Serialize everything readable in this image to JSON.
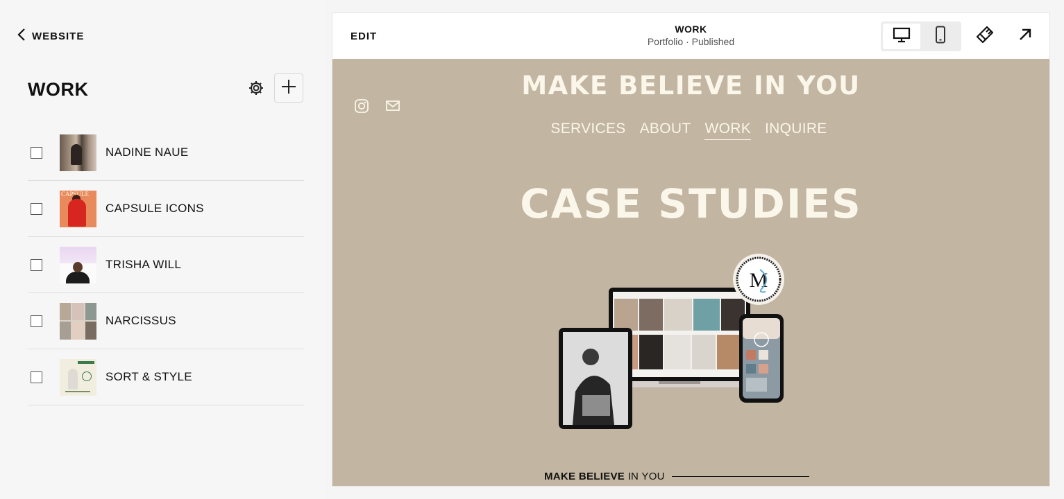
{
  "sidebar": {
    "back_label": "WEBSITE",
    "title": "WORK",
    "items": [
      {
        "label": "NADINE NAUE",
        "checked": false
      },
      {
        "label": "CAPSULE ICONS",
        "checked": false,
        "thumb_text": "CAPSULE"
      },
      {
        "label": "TRISHA WILL",
        "checked": false
      },
      {
        "label": "NARCISSUS",
        "checked": false
      },
      {
        "label": "SORT & STYLE",
        "checked": false
      }
    ]
  },
  "toolbar": {
    "edit_label": "EDIT",
    "page_name": "WORK",
    "page_sub": "Portfolio · Published",
    "active_device": "desktop"
  },
  "site": {
    "title": "MAKE BELIEVE IN YOU",
    "nav": [
      "SERVICES",
      "ABOUT",
      "WORK",
      "INQUIRE"
    ],
    "active_nav": "WORK",
    "heading": "CASE STUDIES",
    "logo_text": "M",
    "footer_bold": "MAKE BELIEVE",
    "footer_rest": " IN YOU",
    "background_color": "#c2b5a1",
    "text_color": "#fbf6ea"
  },
  "icons": {
    "back": "chevron-left-icon",
    "settings": "gear-icon",
    "add": "plus-icon",
    "desktop": "desktop-icon",
    "mobile": "mobile-phone-icon",
    "design": "paintbrush-icon",
    "exit": "arrow-up-right-icon",
    "instagram": "instagram-icon",
    "email": "mail-icon"
  }
}
